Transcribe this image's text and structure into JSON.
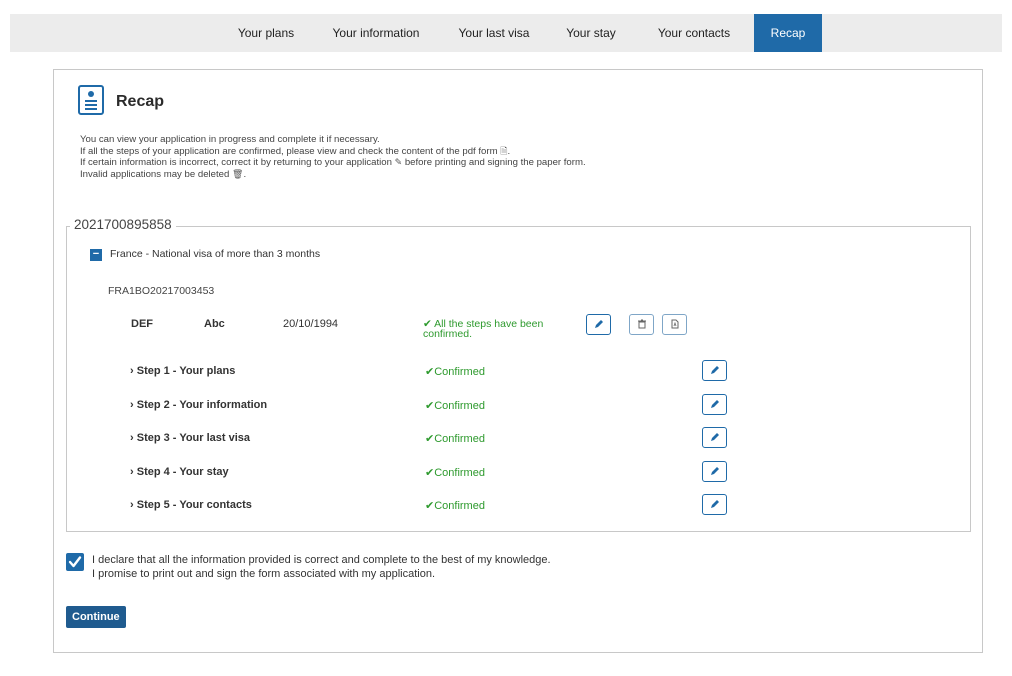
{
  "nav": {
    "tabs": [
      {
        "label": "Your plans"
      },
      {
        "label": "Your information"
      },
      {
        "label": "Your last visa"
      },
      {
        "label": "Your stay"
      },
      {
        "label": "Your contacts"
      },
      {
        "label": "Recap",
        "active": true
      }
    ]
  },
  "page": {
    "title": "Recap",
    "intro": [
      "You can view your application in progress and complete it if necessary.",
      "If all the steps of your application are confirmed, please view and check the content of the pdf form",
      "If certain information is incorrect, correct it by returning to your application",
      "before printing and signing the paper form.",
      "Invalid applications may be deleted"
    ]
  },
  "application": {
    "number": "2021700895858",
    "visa_type": "France - National visa of more than 3 months",
    "reference": "FRA1BO20217003453",
    "applicant": {
      "last_name": "DEF",
      "first_name": "Abc",
      "birth_date": "20/10/1994",
      "status": "All the steps have been confirmed."
    },
    "steps": [
      {
        "label": "Step 1 - Your plans",
        "status": "Confirmed"
      },
      {
        "label": "Step 2 - Your information",
        "status": "Confirmed"
      },
      {
        "label": "Step 3 - Your last visa",
        "status": "Confirmed"
      },
      {
        "label": "Step 4 - Your stay",
        "status": "Confirmed"
      },
      {
        "label": "Step 5 - Your contacts",
        "status": "Confirmed"
      }
    ]
  },
  "declaration": {
    "checked": true,
    "line1": "I declare that all the information provided is correct and complete to the best of my knowledge.",
    "line2": "I promise to print out and sign the form associated with my application."
  },
  "actions": {
    "continue_label": "Continue"
  },
  "colors": {
    "accent": "#1f6aa8",
    "confirmed": "#2e9a2e"
  },
  "icons": {
    "collapse": "minus-icon",
    "step_toggle": "chevron-right-icon",
    "status": "check-icon",
    "edit": "pencil-icon",
    "delete": "trash-icon",
    "pdf": "pdf-icon"
  }
}
